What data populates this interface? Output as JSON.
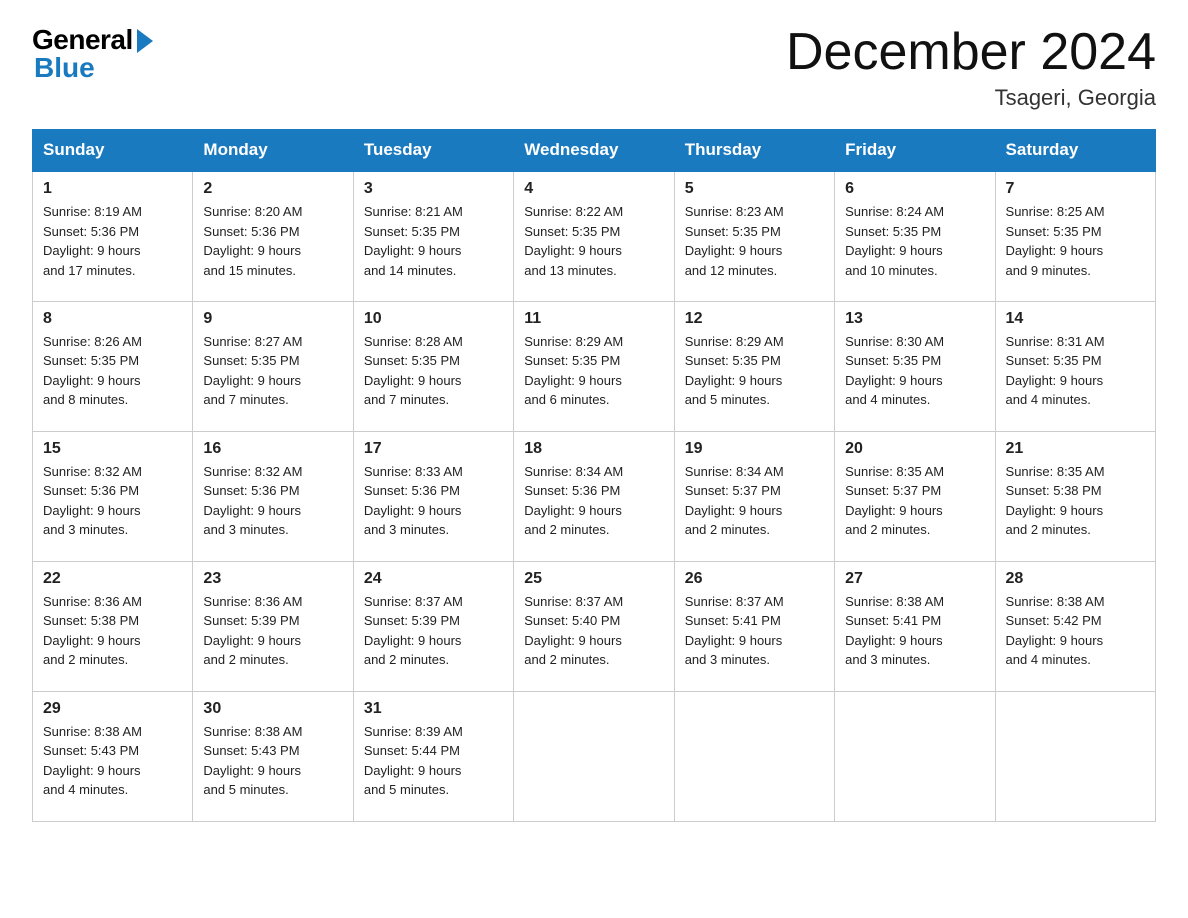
{
  "header": {
    "logo_general": "General",
    "logo_blue": "Blue",
    "title": "December 2024",
    "subtitle": "Tsageri, Georgia"
  },
  "weekdays": [
    "Sunday",
    "Monday",
    "Tuesday",
    "Wednesday",
    "Thursday",
    "Friday",
    "Saturday"
  ],
  "weeks": [
    [
      {
        "day": "1",
        "sunrise": "8:19 AM",
        "sunset": "5:36 PM",
        "daylight": "9 hours and 17 minutes."
      },
      {
        "day": "2",
        "sunrise": "8:20 AM",
        "sunset": "5:36 PM",
        "daylight": "9 hours and 15 minutes."
      },
      {
        "day": "3",
        "sunrise": "8:21 AM",
        "sunset": "5:35 PM",
        "daylight": "9 hours and 14 minutes."
      },
      {
        "day": "4",
        "sunrise": "8:22 AM",
        "sunset": "5:35 PM",
        "daylight": "9 hours and 13 minutes."
      },
      {
        "day": "5",
        "sunrise": "8:23 AM",
        "sunset": "5:35 PM",
        "daylight": "9 hours and 12 minutes."
      },
      {
        "day": "6",
        "sunrise": "8:24 AM",
        "sunset": "5:35 PM",
        "daylight": "9 hours and 10 minutes."
      },
      {
        "day": "7",
        "sunrise": "8:25 AM",
        "sunset": "5:35 PM",
        "daylight": "9 hours and 9 minutes."
      }
    ],
    [
      {
        "day": "8",
        "sunrise": "8:26 AM",
        "sunset": "5:35 PM",
        "daylight": "9 hours and 8 minutes."
      },
      {
        "day": "9",
        "sunrise": "8:27 AM",
        "sunset": "5:35 PM",
        "daylight": "9 hours and 7 minutes."
      },
      {
        "day": "10",
        "sunrise": "8:28 AM",
        "sunset": "5:35 PM",
        "daylight": "9 hours and 7 minutes."
      },
      {
        "day": "11",
        "sunrise": "8:29 AM",
        "sunset": "5:35 PM",
        "daylight": "9 hours and 6 minutes."
      },
      {
        "day": "12",
        "sunrise": "8:29 AM",
        "sunset": "5:35 PM",
        "daylight": "9 hours and 5 minutes."
      },
      {
        "day": "13",
        "sunrise": "8:30 AM",
        "sunset": "5:35 PM",
        "daylight": "9 hours and 4 minutes."
      },
      {
        "day": "14",
        "sunrise": "8:31 AM",
        "sunset": "5:35 PM",
        "daylight": "9 hours and 4 minutes."
      }
    ],
    [
      {
        "day": "15",
        "sunrise": "8:32 AM",
        "sunset": "5:36 PM",
        "daylight": "9 hours and 3 minutes."
      },
      {
        "day": "16",
        "sunrise": "8:32 AM",
        "sunset": "5:36 PM",
        "daylight": "9 hours and 3 minutes."
      },
      {
        "day": "17",
        "sunrise": "8:33 AM",
        "sunset": "5:36 PM",
        "daylight": "9 hours and 3 minutes."
      },
      {
        "day": "18",
        "sunrise": "8:34 AM",
        "sunset": "5:36 PM",
        "daylight": "9 hours and 2 minutes."
      },
      {
        "day": "19",
        "sunrise": "8:34 AM",
        "sunset": "5:37 PM",
        "daylight": "9 hours and 2 minutes."
      },
      {
        "day": "20",
        "sunrise": "8:35 AM",
        "sunset": "5:37 PM",
        "daylight": "9 hours and 2 minutes."
      },
      {
        "day": "21",
        "sunrise": "8:35 AM",
        "sunset": "5:38 PM",
        "daylight": "9 hours and 2 minutes."
      }
    ],
    [
      {
        "day": "22",
        "sunrise": "8:36 AM",
        "sunset": "5:38 PM",
        "daylight": "9 hours and 2 minutes."
      },
      {
        "day": "23",
        "sunrise": "8:36 AM",
        "sunset": "5:39 PM",
        "daylight": "9 hours and 2 minutes."
      },
      {
        "day": "24",
        "sunrise": "8:37 AM",
        "sunset": "5:39 PM",
        "daylight": "9 hours and 2 minutes."
      },
      {
        "day": "25",
        "sunrise": "8:37 AM",
        "sunset": "5:40 PM",
        "daylight": "9 hours and 2 minutes."
      },
      {
        "day": "26",
        "sunrise": "8:37 AM",
        "sunset": "5:41 PM",
        "daylight": "9 hours and 3 minutes."
      },
      {
        "day": "27",
        "sunrise": "8:38 AM",
        "sunset": "5:41 PM",
        "daylight": "9 hours and 3 minutes."
      },
      {
        "day": "28",
        "sunrise": "8:38 AM",
        "sunset": "5:42 PM",
        "daylight": "9 hours and 4 minutes."
      }
    ],
    [
      {
        "day": "29",
        "sunrise": "8:38 AM",
        "sunset": "5:43 PM",
        "daylight": "9 hours and 4 minutes."
      },
      {
        "day": "30",
        "sunrise": "8:38 AM",
        "sunset": "5:43 PM",
        "daylight": "9 hours and 5 minutes."
      },
      {
        "day": "31",
        "sunrise": "8:39 AM",
        "sunset": "5:44 PM",
        "daylight": "9 hours and 5 minutes."
      },
      null,
      null,
      null,
      null
    ]
  ],
  "labels": {
    "sunrise": "Sunrise:",
    "sunset": "Sunset:",
    "daylight": "Daylight:"
  }
}
